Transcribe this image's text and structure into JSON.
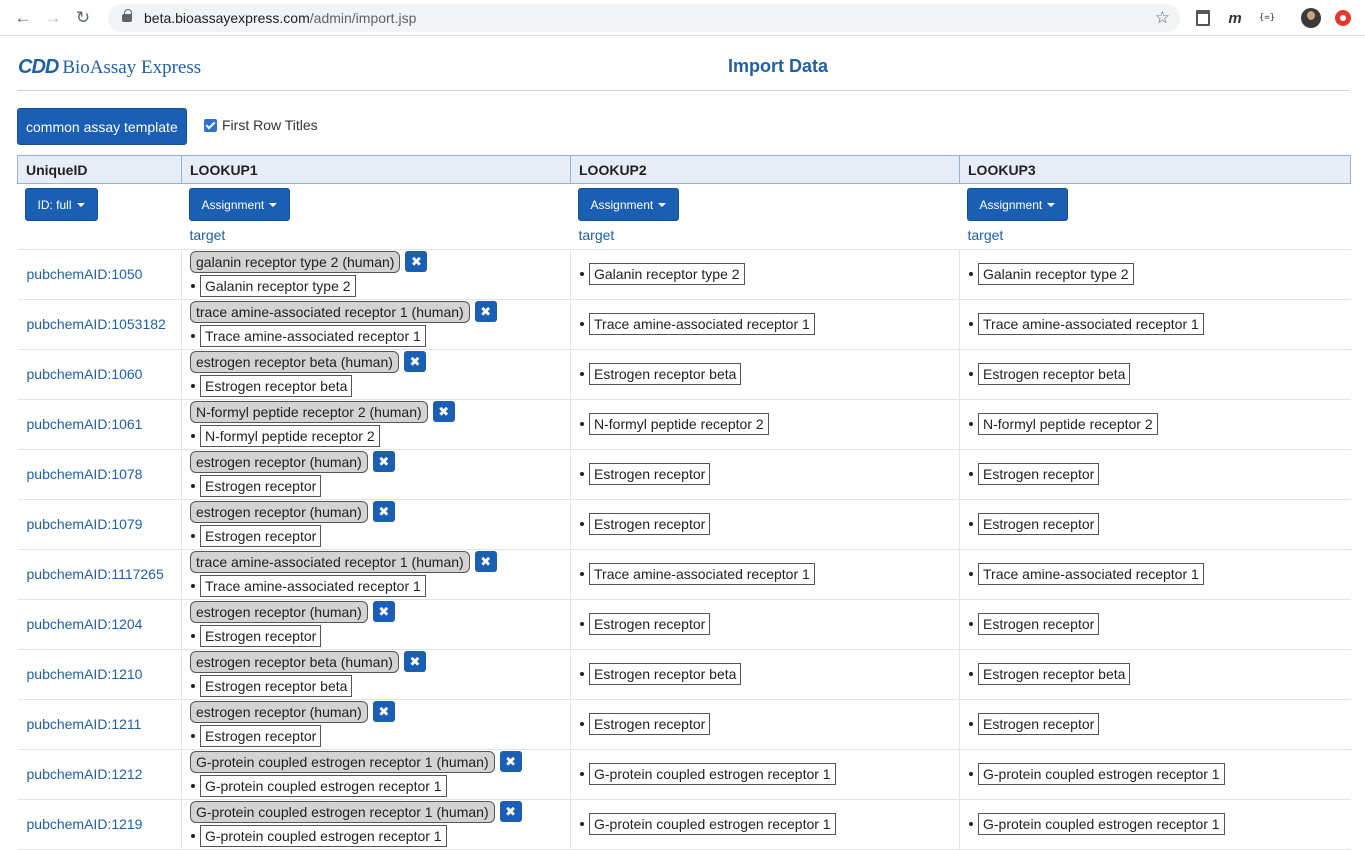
{
  "browser": {
    "url_host": "beta.bioassayexpress.com",
    "url_path": "/admin/import.jsp",
    "extensions": [
      "trash-icon",
      "m-extension-icon",
      "json-extension-icon",
      "profile-avatar",
      "stop-extension-icon"
    ]
  },
  "header": {
    "logo_mark": "CDD",
    "logo_text": "BioAssay Express",
    "title": "Import Data"
  },
  "toolbar": {
    "template_button": "common assay template",
    "first_row_titles_label": "First Row Titles",
    "first_row_titles_checked": true
  },
  "table": {
    "columns": [
      "UniqueID",
      "LOOKUP1",
      "LOOKUP2",
      "LOOKUP3"
    ],
    "id_dropdown": "ID: full",
    "assignment_dropdown": "Assignment",
    "property_label": "target",
    "rows": [
      {
        "id": "pubchemAID:1050",
        "lookup1_pill": "galanin receptor type 2 (human)",
        "lookup1_term": "Galanin receptor type 2",
        "lookup2": "Galanin receptor type 2",
        "lookup3": "Galanin receptor type 2"
      },
      {
        "id": "pubchemAID:1053182",
        "lookup1_pill": "trace amine-associated receptor 1 (human)",
        "lookup1_term": "Trace amine-associated receptor 1",
        "lookup2": "Trace amine-associated receptor 1",
        "lookup3": "Trace amine-associated receptor 1"
      },
      {
        "id": "pubchemAID:1060",
        "lookup1_pill": "estrogen receptor beta (human)",
        "lookup1_term": "Estrogen receptor beta",
        "lookup2": "Estrogen receptor beta",
        "lookup3": "Estrogen receptor beta"
      },
      {
        "id": "pubchemAID:1061",
        "lookup1_pill": "N-formyl peptide receptor 2 (human)",
        "lookup1_term": "N-formyl peptide receptor 2",
        "lookup2": "N-formyl peptide receptor 2",
        "lookup3": "N-formyl peptide receptor 2"
      },
      {
        "id": "pubchemAID:1078",
        "lookup1_pill": "estrogen receptor (human)",
        "lookup1_term": "Estrogen receptor",
        "lookup2": "Estrogen receptor",
        "lookup3": "Estrogen receptor"
      },
      {
        "id": "pubchemAID:1079",
        "lookup1_pill": "estrogen receptor (human)",
        "lookup1_term": "Estrogen receptor",
        "lookup2": "Estrogen receptor",
        "lookup3": "Estrogen receptor"
      },
      {
        "id": "pubchemAID:1117265",
        "lookup1_pill": "trace amine-associated receptor 1 (human)",
        "lookup1_term": "Trace amine-associated receptor 1",
        "lookup2": "Trace amine-associated receptor 1",
        "lookup3": "Trace amine-associated receptor 1"
      },
      {
        "id": "pubchemAID:1204",
        "lookup1_pill": "estrogen receptor (human)",
        "lookup1_term": "Estrogen receptor",
        "lookup2": "Estrogen receptor",
        "lookup3": "Estrogen receptor"
      },
      {
        "id": "pubchemAID:1210",
        "lookup1_pill": "estrogen receptor beta (human)",
        "lookup1_term": "Estrogen receptor beta",
        "lookup2": "Estrogen receptor beta",
        "lookup3": "Estrogen receptor beta"
      },
      {
        "id": "pubchemAID:1211",
        "lookup1_pill": "estrogen receptor (human)",
        "lookup1_term": "Estrogen receptor",
        "lookup2": "Estrogen receptor",
        "lookup3": "Estrogen receptor"
      },
      {
        "id": "pubchemAID:1212",
        "lookup1_pill": "G-protein coupled estrogen receptor 1 (human)",
        "lookup1_term": "G-protein coupled estrogen receptor 1",
        "lookup2": "G-protein coupled estrogen receptor 1",
        "lookup3": "G-protein coupled estrogen receptor 1"
      },
      {
        "id": "pubchemAID:1219",
        "lookup1_pill": "G-protein coupled estrogen receptor 1 (human)",
        "lookup1_term": "G-protein coupled estrogen receptor 1",
        "lookup2": "G-protein coupled estrogen receptor 1",
        "lookup3": "G-protein coupled estrogen receptor 1"
      }
    ]
  }
}
